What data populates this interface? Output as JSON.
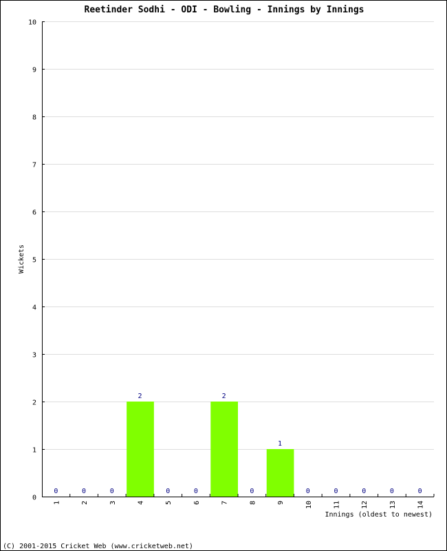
{
  "chart_data": {
    "type": "bar",
    "title": "Reetinder Sodhi - ODI - Bowling - Innings by Innings",
    "xlabel": "Innings (oldest to newest)",
    "ylabel": "Wickets",
    "categories": [
      "1",
      "2",
      "3",
      "4",
      "5",
      "6",
      "7",
      "8",
      "9",
      "10",
      "11",
      "12",
      "13",
      "14"
    ],
    "values": [
      0,
      0,
      0,
      2,
      0,
      0,
      2,
      0,
      1,
      0,
      0,
      0,
      0,
      0
    ],
    "ylim": [
      0,
      10
    ],
    "yticks": [
      0,
      1,
      2,
      3,
      4,
      5,
      6,
      7,
      8,
      9,
      10
    ],
    "grid": true,
    "bar_color": "#80ff00",
    "label_color": "#000080",
    "grid_color": "#dddddd"
  },
  "footer": "(C) 2001-2015 Cricket Web (www.cricketweb.net)"
}
